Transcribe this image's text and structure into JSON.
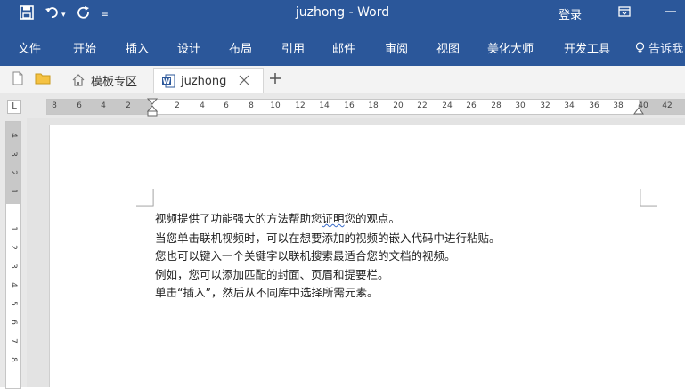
{
  "title_bar": {
    "doc_title": "juzhong - Word",
    "login_label": "登录"
  },
  "ribbon": {
    "tabs": [
      "文件",
      "开始",
      "插入",
      "设计",
      "布局",
      "引用",
      "邮件",
      "审阅",
      "视图",
      "美化大师",
      "开发工具"
    ],
    "tell_me": "告诉我"
  },
  "doc_tabs": {
    "templates_label": "模板专区",
    "current_doc": "juzhong"
  },
  "ruler": {
    "tab_selector": "L",
    "h_ticks": [
      "8",
      "6",
      "4",
      "2",
      "",
      "2",
      "4",
      "6",
      "8",
      "10",
      "12",
      "14",
      "16",
      "18",
      "20",
      "22",
      "24",
      "26",
      "28",
      "30",
      "32",
      "34",
      "36",
      "38",
      "40",
      "42"
    ],
    "v_ticks": [
      "4",
      "3",
      "2",
      "1",
      "",
      "1",
      "2",
      "3",
      "4",
      "5",
      "6",
      "7",
      "8"
    ]
  },
  "document": {
    "lines": [
      "视频提供了功能强大的方法帮助您证明您的观点。",
      "当您单击联机视频时，可以在想要添加的视频的嵌入代码中进行粘贴。",
      "您也可以键入一个关键字以联机搜索最适合您的文档的视频。",
      "例如，您可以添加匹配的封面、页眉和提要栏。",
      "单击“插入”，然后从不同库中选择所需元素。"
    ],
    "line1_prefix": "视频提供了功能强大的方法帮助您",
    "line1_marked": "证明",
    "line1_suffix": "您的观点。"
  },
  "colors": {
    "accent": "#2b579a",
    "ribbon_text": "#ffffff"
  }
}
